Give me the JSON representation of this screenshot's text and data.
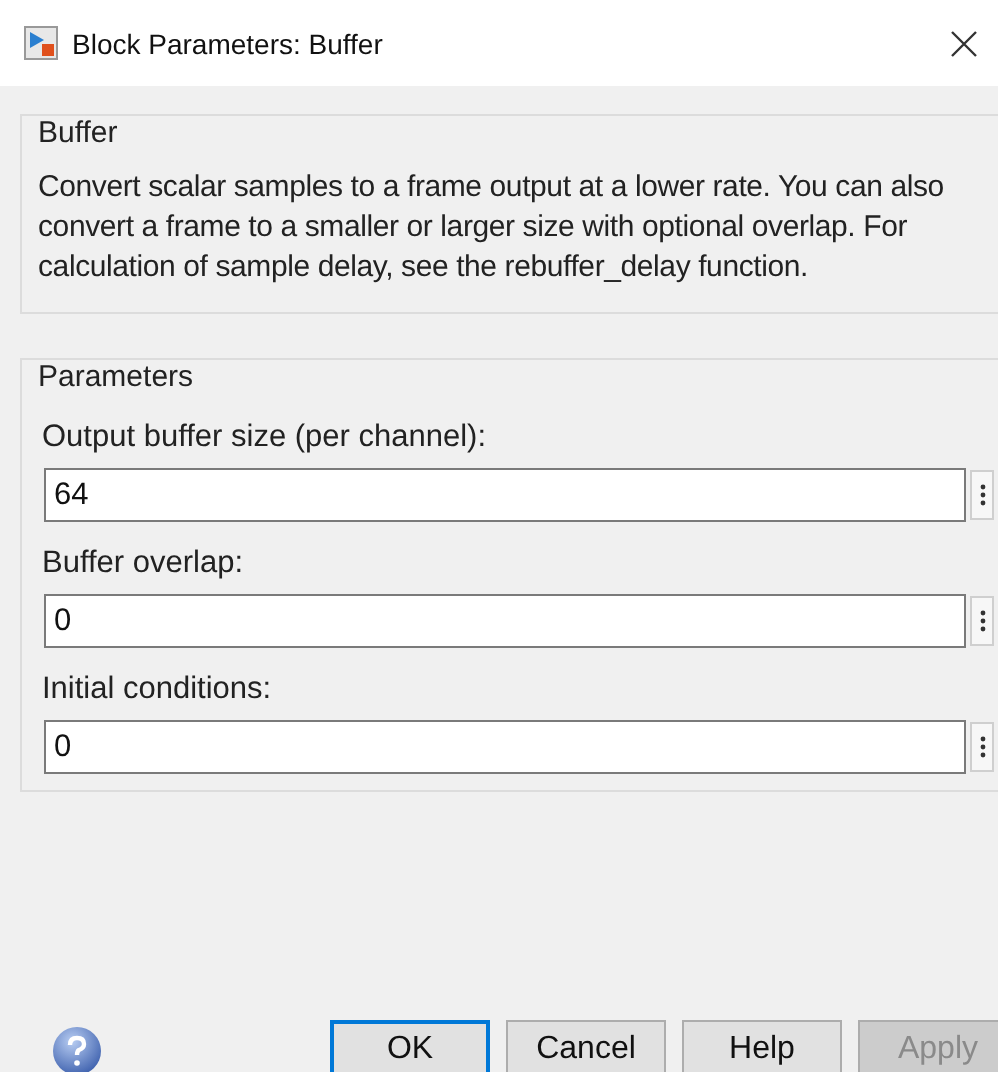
{
  "window": {
    "title": "Block Parameters: Buffer"
  },
  "description_group": {
    "title": "Buffer",
    "text": "Convert scalar samples to a frame output at a lower rate. You can also convert a frame to a smaller or larger size with optional overlap. For calculation of sample delay, see the rebuffer_delay function."
  },
  "parameters_group": {
    "title": "Parameters",
    "fields": [
      {
        "label": "Output buffer size (per channel):",
        "value": "64"
      },
      {
        "label": "Buffer overlap:",
        "value": "0"
      },
      {
        "label": "Initial conditions:",
        "value": "0"
      }
    ]
  },
  "buttons": [
    {
      "label": "OK",
      "default": true,
      "disabled": false
    },
    {
      "label": "Cancel",
      "default": false,
      "disabled": false
    },
    {
      "label": "Help",
      "default": false,
      "disabled": false
    },
    {
      "label": "Apply",
      "default": false,
      "disabled": true
    }
  ]
}
